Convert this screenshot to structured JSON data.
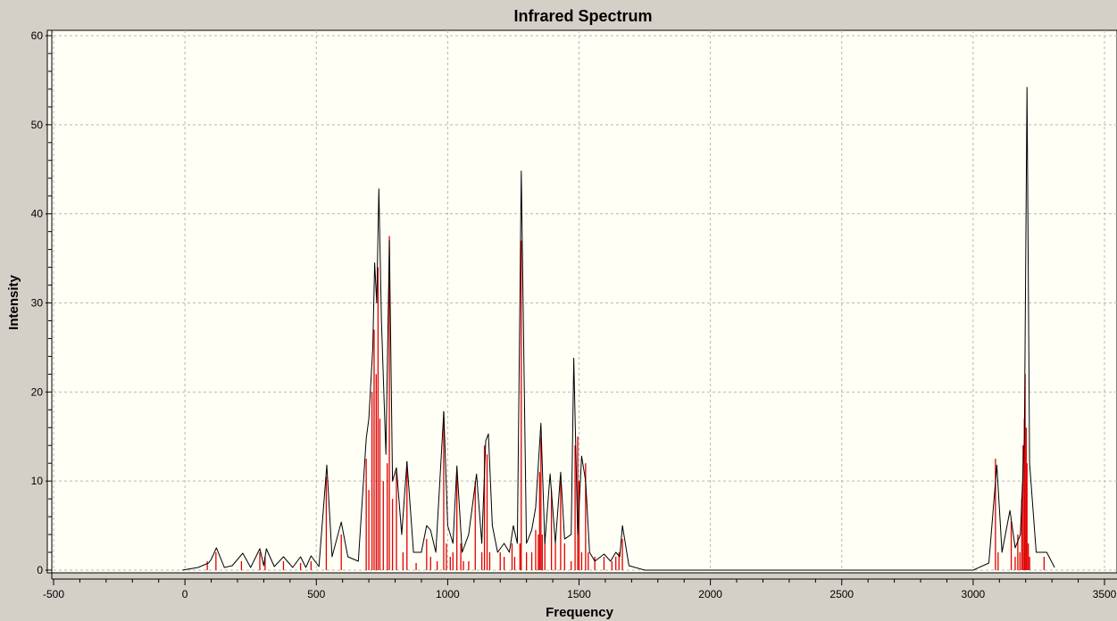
{
  "window": {
    "title": "Infrared Spectrum"
  },
  "colors": {
    "background": "#d4d0c8",
    "plot_background": "#fffff6",
    "grid": "#b8b8b8",
    "curve": "#000000",
    "sticks": "#e00000"
  },
  "chart_data": {
    "type": "line",
    "title": "Infrared Spectrum",
    "xlabel": "Frequency",
    "ylabel": "Intensity",
    "xlim": [
      -500,
      3500
    ],
    "ylim": [
      0,
      60
    ],
    "x_ticks": [
      -500,
      0,
      500,
      1000,
      1500,
      2000,
      2500,
      3000,
      3500
    ],
    "y_ticks": [
      0,
      10,
      20,
      30,
      40,
      50,
      60
    ],
    "grid": true,
    "legend": "none",
    "series": [
      {
        "kind": "spectrum-curve",
        "color": "#000000",
        "x": [
          -10,
          50,
          90,
          100,
          120,
          150,
          180,
          220,
          250,
          285,
          300,
          310,
          340,
          375,
          410,
          440,
          460,
          480,
          510,
          540,
          560,
          595,
          620,
          660,
          690,
          700,
          715,
          722,
          730,
          738,
          748,
          765,
          778,
          790,
          805,
          825,
          845,
          870,
          900,
          920,
          935,
          955,
          985,
          1000,
          1020,
          1035,
          1055,
          1080,
          1110,
          1130,
          1145,
          1155,
          1170,
          1190,
          1215,
          1235,
          1250,
          1265,
          1280,
          1300,
          1320,
          1335,
          1355,
          1370,
          1390,
          1410,
          1430,
          1445,
          1470,
          1480,
          1495,
          1510,
          1525,
          1540,
          1560,
          1595,
          1620,
          1640,
          1655,
          1665,
          1690,
          1750,
          2000,
          2500,
          3000,
          3060,
          3090,
          3110,
          3140,
          3160,
          3180,
          3195,
          3205,
          3215,
          3240,
          3280,
          3310
        ],
        "y": [
          0,
          0.3,
          0.8,
          1.2,
          2.5,
          0.3,
          0.5,
          1.9,
          0.3,
          2.4,
          0.5,
          2.4,
          0.4,
          1.5,
          0.3,
          1.5,
          0.3,
          1.6,
          0.4,
          11.8,
          1.5,
          5.4,
          1.5,
          1.0,
          14.8,
          17.0,
          25.0,
          34.5,
          30.0,
          42.8,
          28.0,
          13.0,
          37.0,
          10.0,
          11.5,
          4.0,
          12.2,
          2.0,
          2.0,
          5.0,
          4.5,
          2.0,
          17.8,
          5.0,
          3.0,
          11.7,
          2.0,
          4.0,
          10.8,
          3.0,
          14.5,
          15.3,
          5.0,
          2.0,
          3.0,
          2.0,
          5.0,
          3.0,
          44.8,
          3.0,
          4.5,
          7.0,
          16.5,
          3.0,
          10.8,
          3.0,
          11.0,
          3.5,
          4.0,
          23.8,
          4.0,
          12.8,
          10.0,
          2.0,
          1.0,
          1.8,
          1.0,
          2.0,
          1.5,
          5.0,
          0.5,
          0,
          0,
          0,
          0,
          0.8,
          11.8,
          2.0,
          6.7,
          2.5,
          4.0,
          15.0,
          54.2,
          12.0,
          2.0,
          2.0,
          0.3
        ]
      },
      {
        "kind": "stick-spectrum",
        "color": "#e00000",
        "x": [
          85,
          118,
          215,
          285,
          305,
          375,
          440,
          480,
          538,
          595,
          690,
          700,
          712,
          720,
          728,
          735,
          742,
          755,
          770,
          778,
          790,
          805,
          830,
          845,
          880,
          920,
          935,
          960,
          985,
          995,
          1010,
          1020,
          1035,
          1050,
          1060,
          1080,
          1105,
          1130,
          1140,
          1150,
          1160,
          1200,
          1215,
          1245,
          1255,
          1275,
          1280,
          1300,
          1320,
          1335,
          1345,
          1350,
          1355,
          1360,
          1370,
          1395,
          1410,
          1430,
          1445,
          1470,
          1485,
          1495,
          1500,
          1510,
          1525,
          1535,
          1560,
          1595,
          1625,
          1640,
          1652,
          1665,
          3085,
          3095,
          3145,
          3160,
          3170,
          3178,
          3185,
          3190,
          3195,
          3198,
          3202,
          3205,
          3210,
          3215,
          3270
        ],
        "y": [
          1.0,
          2.0,
          1.0,
          2.0,
          1.5,
          1.0,
          0.8,
          1.0,
          10.5,
          4.0,
          12.5,
          9.0,
          20.0,
          27.0,
          22.0,
          34.0,
          17.0,
          10.0,
          12.0,
          37.5,
          8.0,
          11.0,
          2.0,
          12.2,
          0.8,
          3.5,
          1.5,
          1.0,
          17.8,
          3.0,
          1.5,
          2.0,
          11.0,
          3.0,
          1.0,
          1.0,
          10.0,
          2.0,
          14.0,
          13.0,
          2.0,
          2.0,
          1.5,
          3.0,
          1.5,
          3.0,
          37.0,
          2.0,
          2.0,
          4.5,
          4.0,
          11.0,
          15.0,
          4.0,
          3.5,
          9.0,
          3.0,
          10.0,
          3.0,
          1.0,
          14.0,
          15.0,
          10.0,
          2.0,
          12.0,
          2.0,
          1.5,
          1.5,
          1.0,
          1.5,
          2.0,
          3.5,
          12.5,
          2.0,
          5.5,
          1.5,
          4.0,
          2.0,
          8.0,
          14.0,
          17.0,
          22.0,
          16.0,
          12.0,
          3.0,
          1.5,
          1.5
        ]
      }
    ]
  }
}
